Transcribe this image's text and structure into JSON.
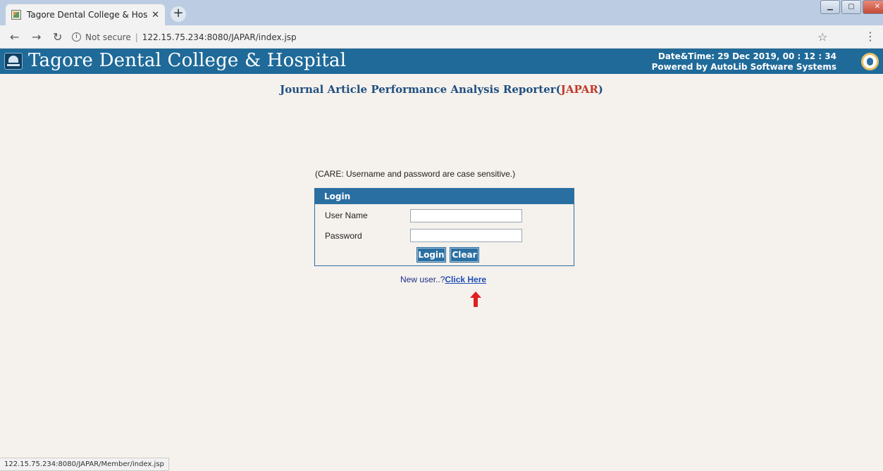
{
  "browser": {
    "tab_title": "Tagore Dental College & Hospita",
    "tab_close": "✕",
    "new_tab": "+",
    "not_secure": "Not secure",
    "url": "122.15.75.234:8080/JAPAR/index.jsp",
    "status_url": "122.15.75.234:8080/JAPAR/Member/index.jsp"
  },
  "header": {
    "college_name": "Tagore Dental College & Hospital",
    "datetime": "Date&Time:  29 Dec 2019, 00 : 12 : 34",
    "powered_by": "Powered by AutoLib Software Systems"
  },
  "app": {
    "title_prefix": "Journal Article Performance Analysis Reporter(",
    "title_acronym": "JAPAR",
    "title_suffix": ")"
  },
  "login": {
    "care_note": "(CARE: Username and password are case sensitive.)",
    "heading": "Login",
    "username_label": "User Name",
    "username_value": "",
    "password_label": "Password",
    "password_value": "",
    "login_button": "Login",
    "clear_button": "Clear"
  },
  "signup": {
    "prompt": "New user..?",
    "link": "Click Here"
  },
  "colors": {
    "header_blue": "#1f6a99",
    "page_bg": "#f5f1ec",
    "acronym_red": "#c0392b",
    "arrow_red": "#e02020"
  }
}
